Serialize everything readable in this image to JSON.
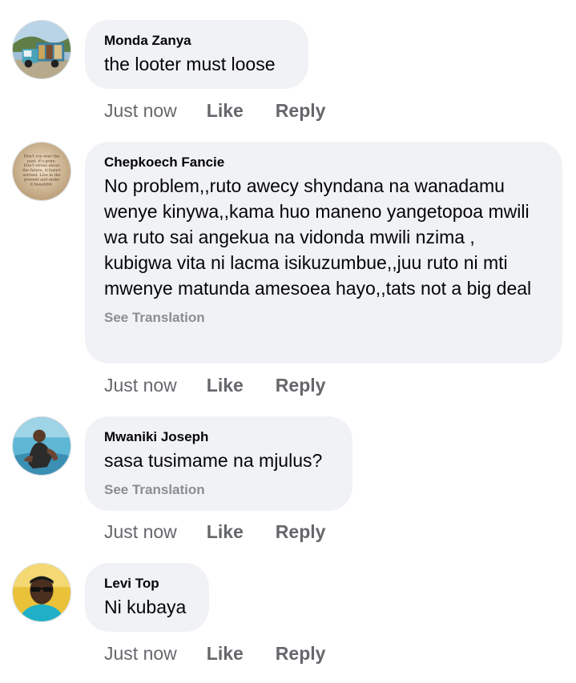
{
  "comments": [
    {
      "author": "Monda Zanya",
      "text": "the looter must loose",
      "see_translation": "",
      "time": "Just now",
      "like": "Like",
      "reply": "Reply",
      "avatar_icon": "truck-photo-avatar"
    },
    {
      "author": "Chepkoech Fancie",
      "text": "No problem,,ruto awecy shyndana na wanadamu wenye kinywa,,kama huo maneno yangetopoa mwili wa ruto sai angekua na vidonda mwili nzima , kubigwa vita ni lacma isikuzumbue,,juu ruto ni mti mwenye matunda amesoea hayo,,tats not a big deal",
      "see_translation": "See Translation",
      "time": "Just now",
      "like": "Like",
      "reply": "Reply",
      "avatar_icon": "quote-text-avatar",
      "avatar_text": [
        "Don't cry over the",
        "past, it's gone.",
        "Don't stress about",
        "the future, it hasn't",
        "arrived. Live in the",
        "present and make",
        "it beautiful."
      ]
    },
    {
      "author": "Mwaniki Joseph",
      "text": "sasa tusimame na mjulus?",
      "see_translation": "See Translation",
      "time": "Just now",
      "like": "Like",
      "reply": "Reply",
      "avatar_icon": "person-pool-avatar"
    },
    {
      "author": "Levi Top",
      "text": "Ni kubaya",
      "see_translation": "",
      "time": "Just now",
      "like": "Like",
      "reply": "Reply",
      "avatar_icon": "person-sunglasses-avatar"
    }
  ],
  "colors": {
    "bubble_bg": "#f0f2f5",
    "secondary_text": "#65676b",
    "muted_text": "#8a8d91"
  }
}
